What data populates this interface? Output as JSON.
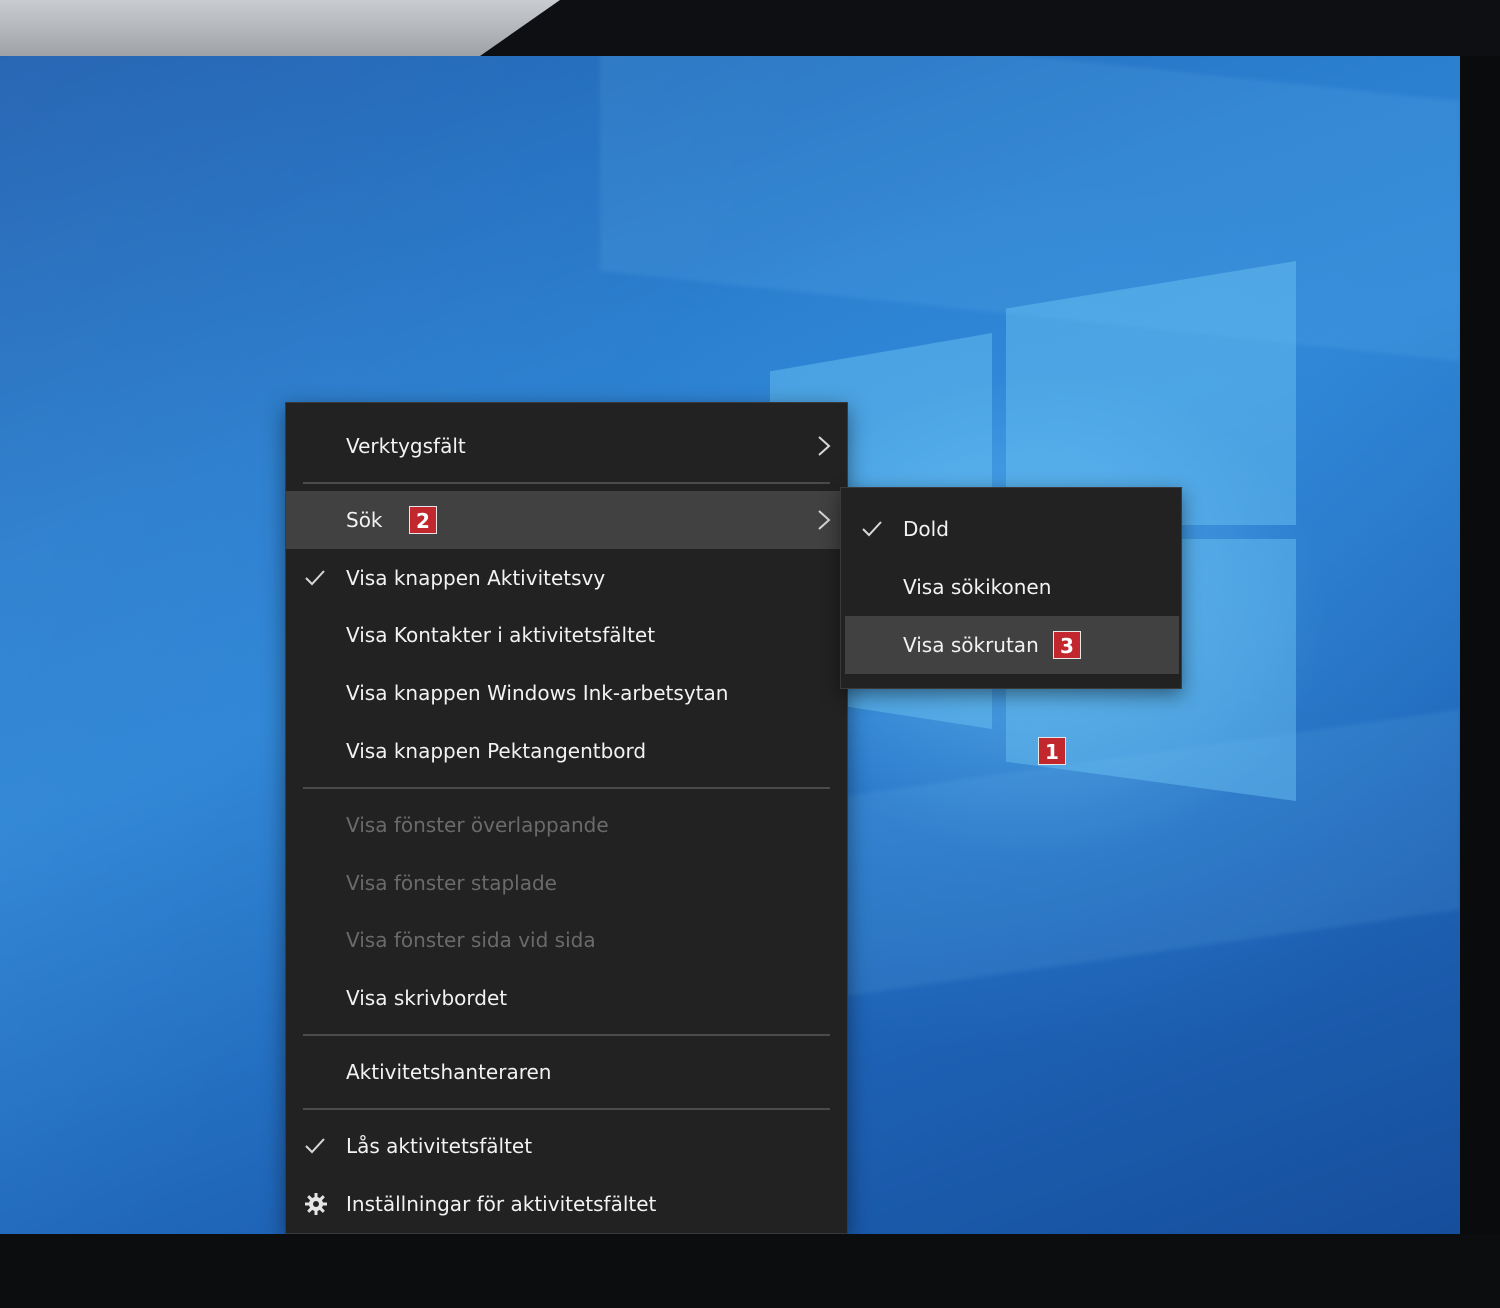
{
  "context_menu": {
    "items": [
      {
        "label": "Verktygsfält",
        "checked": false,
        "submenu": true,
        "disabled": false
      },
      {
        "label": "Sök",
        "checked": false,
        "submenu": true,
        "disabled": false,
        "highlighted": true,
        "badge": "2"
      },
      {
        "label": "Visa knappen Aktivitetsvy",
        "checked": true,
        "disabled": false
      },
      {
        "label": "Visa Kontakter i aktivitetsfältet",
        "checked": false,
        "disabled": false
      },
      {
        "label": "Visa knappen Windows Ink-arbetsytan",
        "checked": false,
        "disabled": false
      },
      {
        "label": "Visa knappen Pektangentbord",
        "checked": false,
        "disabled": false
      },
      {
        "label": "Visa fönster överlappande",
        "checked": false,
        "disabled": true
      },
      {
        "label": "Visa fönster staplade",
        "checked": false,
        "disabled": true
      },
      {
        "label": "Visa fönster sida vid sida",
        "checked": false,
        "disabled": true
      },
      {
        "label": "Visa skrivbordet",
        "checked": false,
        "disabled": false
      },
      {
        "label": "Aktivitetshanteraren",
        "checked": false,
        "disabled": false
      },
      {
        "label": "Lås aktivitetsfältet",
        "checked": true,
        "disabled": false
      },
      {
        "label": "Inställningar för aktivitetsfältet",
        "checked": false,
        "disabled": false,
        "icon": "gear-icon"
      }
    ]
  },
  "search_submenu": {
    "items": [
      {
        "label": "Dold",
        "checked": true
      },
      {
        "label": "Visa sökikonen",
        "checked": false
      },
      {
        "label": "Visa sökrutan",
        "checked": false,
        "highlighted": true,
        "badge": "3"
      }
    ]
  },
  "annotations": {
    "desktop_badge": "1"
  },
  "colors": {
    "menu_bg": "#222222",
    "highlight_bg": "#414141",
    "badge_red": "#c1272d",
    "disabled_text": "#6a6a6a"
  }
}
